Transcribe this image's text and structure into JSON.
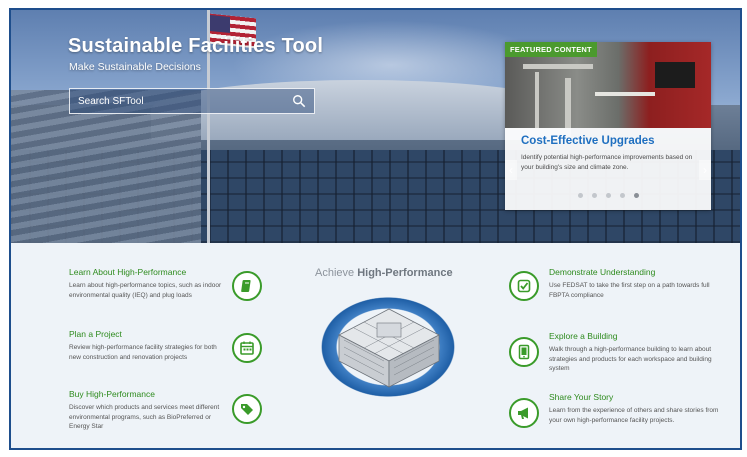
{
  "header": {
    "title": "Sustainable Facilities Tool",
    "subtitle": "Make Sustainable Decisions"
  },
  "search": {
    "placeholder": "Search SFTool",
    "icon": "search-icon"
  },
  "featured": {
    "badge": "FEATURED CONTENT",
    "title": "Cost-Effective Upgrades",
    "description": "Identify potential high-performance improvements based on your building's size and climate zone.",
    "slide_count": 5,
    "active_slide": 5,
    "prev_icon": "chevron-left-icon",
    "next_icon": "chevron-right-icon"
  },
  "center": {
    "title_prefix": "Achieve",
    "title_bold": "High-Performance"
  },
  "features_left": [
    {
      "title": "Learn About High-Performance",
      "description": "Learn about high-performance topics, such as indoor environmental quality (IEQ) and plug loads",
      "icon": "book-icon"
    },
    {
      "title": "Plan a Project",
      "description": "Review high-performance facility strategies for both new construction and renovation projects",
      "icon": "calendar-icon"
    },
    {
      "title": "Buy High-Performance",
      "description": "Discover which products and services meet different environmental programs, such as BioPreferred or Energy Star",
      "icon": "tag-icon"
    }
  ],
  "features_right": [
    {
      "title": "Demonstrate Understanding",
      "description": "Use FEDSAT to take the first step on a path towards full FBPTA compliance",
      "icon": "checkbox-icon"
    },
    {
      "title": "Explore a Building",
      "description": "Walk through a high-performance building to learn about strategies and products for each workspace and building system",
      "icon": "tablet-icon"
    },
    {
      "title": "Share Your Story",
      "description": "Learn from the experience of others and share stories from your own high-performance facility projects.",
      "icon": "megaphone-icon"
    }
  ],
  "colors": {
    "accent_green": "#3a9b2a",
    "link_blue": "#1f6fc0",
    "border_blue": "#1e4e8c"
  }
}
